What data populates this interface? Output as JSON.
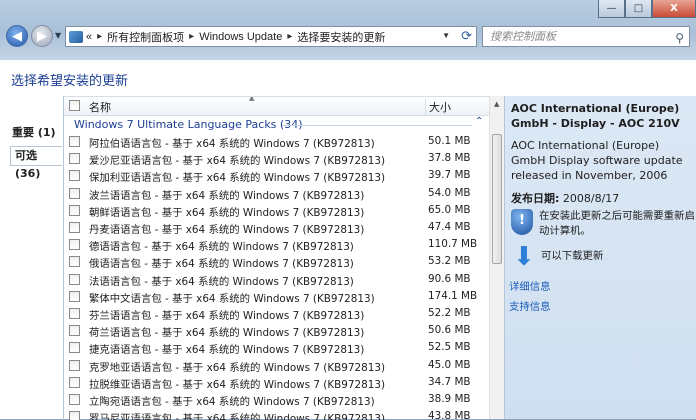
{
  "window": {
    "minimize_label": "—",
    "maximize_label": "□",
    "close_label": "X"
  },
  "nav": {
    "back_glyph": "◀",
    "forward_glyph": "▶"
  },
  "address": {
    "prefix": "«",
    "crumbs": [
      "所有控制面板项",
      "Windows Update",
      "选择要安装的更新"
    ]
  },
  "search": {
    "placeholder": "搜索控制面板"
  },
  "page": {
    "heading": "选择希望安装的更新"
  },
  "left_nav": {
    "important": "重要 (1)",
    "optional": "可选 (36)"
  },
  "list": {
    "col_name": "名称",
    "col_size": "大小",
    "group_title": "Windows 7 Ultimate Language Packs (34)",
    "rows": [
      {
        "name": "阿拉伯语语言包 - 基于 x64 系统的 Windows 7 (KB972813)",
        "size": "50.1 MB"
      },
      {
        "name": "爱沙尼亚语语言包 - 基于 x64 系统的 Windows 7 (KB972813)",
        "size": "37.8 MB"
      },
      {
        "name": "保加利亚语语言包 - 基于 x64 系统的 Windows 7 (KB972813)",
        "size": "39.7 MB"
      },
      {
        "name": "波兰语语言包 - 基于 x64 系统的 Windows 7 (KB972813)",
        "size": "54.0 MB"
      },
      {
        "name": "朝鲜语语言包 - 基于 x64 系统的 Windows 7 (KB972813)",
        "size": "65.0 MB"
      },
      {
        "name": "丹麦语语言包 - 基于 x64 系统的 Windows 7 (KB972813)",
        "size": "47.4 MB"
      },
      {
        "name": "德语语言包 - 基于 x64 系统的 Windows 7 (KB972813)",
        "size": "110.7 MB"
      },
      {
        "name": "俄语语言包 - 基于 x64 系统的 Windows 7 (KB972813)",
        "size": "53.2 MB"
      },
      {
        "name": "法语语言包 - 基于 x64 系统的 Windows 7 (KB972813)",
        "size": "90.6 MB"
      },
      {
        "name": "繁体中文语言包 - 基于 x64 系统的 Windows 7 (KB972813)",
        "size": "174.1 MB"
      },
      {
        "name": "芬兰语语言包 - 基于 x64 系统的 Windows 7 (KB972813)",
        "size": "52.2 MB"
      },
      {
        "name": "荷兰语语言包 - 基于 x64 系统的 Windows 7 (KB972813)",
        "size": "50.6 MB"
      },
      {
        "name": "捷克语语言包 - 基于 x64 系统的 Windows 7 (KB972813)",
        "size": "52.5 MB"
      },
      {
        "name": "克罗地亚语语言包 - 基于 x64 系统的 Windows 7 (KB972813)",
        "size": "45.0 MB"
      },
      {
        "name": "拉脱维亚语语言包 - 基于 x64 系统的 Windows 7 (KB972813)",
        "size": "34.7 MB"
      },
      {
        "name": "立陶宛语语言包 - 基于 x64 系统的 Windows 7 (KB972813)",
        "size": "38.9 MB"
      },
      {
        "name": "罗马尼亚语语言包 - 基于 x64 系统的 Windows 7 (KB972813)",
        "size": "43.8 MB"
      }
    ]
  },
  "detail": {
    "title": "AOC International (Europe) GmbH - Display - AOC 210V",
    "description": "AOC International (Europe) GmbH Display software update released in November, 2006",
    "date_label": "发布日期:",
    "date_value": "2008/8/17",
    "restart_notice": "在安装此更新之后可能需要重新启动计算机。",
    "download_notice": "可以下载更新",
    "link_details": "详细信息",
    "link_support": "支持信息"
  },
  "colors": {
    "heading_blue": "#1c3f94",
    "link_blue": "#1a5cb8",
    "detail_bg": "#dce8f5"
  }
}
